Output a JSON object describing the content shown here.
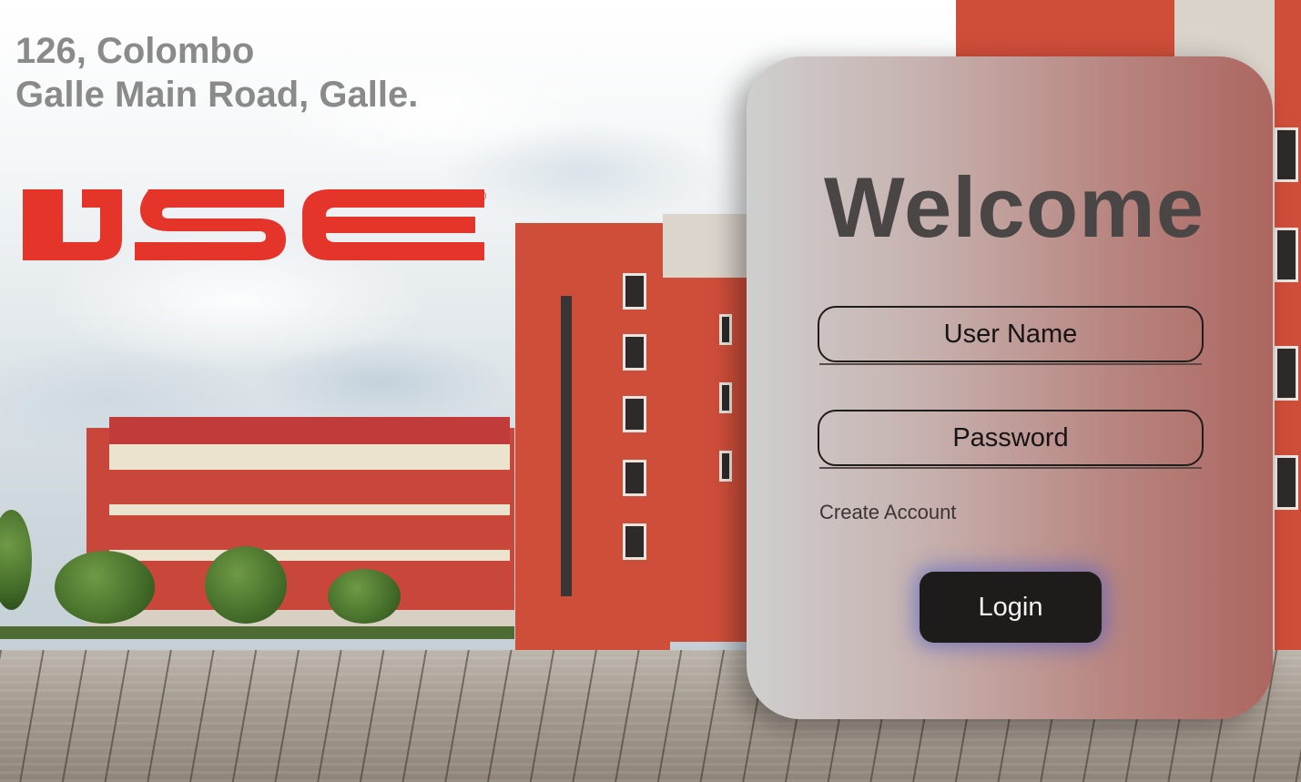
{
  "address": {
    "line1": "126, Colombo",
    "line2": "Galle Main Road, Galle."
  },
  "logo": {
    "text": "IJSE",
    "registered_mark": "®",
    "color": "#e5342a"
  },
  "login": {
    "title": "Welcome",
    "username_placeholder": "User Name",
    "password_placeholder": "Password",
    "create_account_link": "Create Account",
    "login_button": "Login"
  },
  "colors": {
    "address_text": "#8a8a8a",
    "title_text": "#4a4646",
    "button_bg": "#1e1b1b",
    "button_glow": "#465ac8"
  }
}
